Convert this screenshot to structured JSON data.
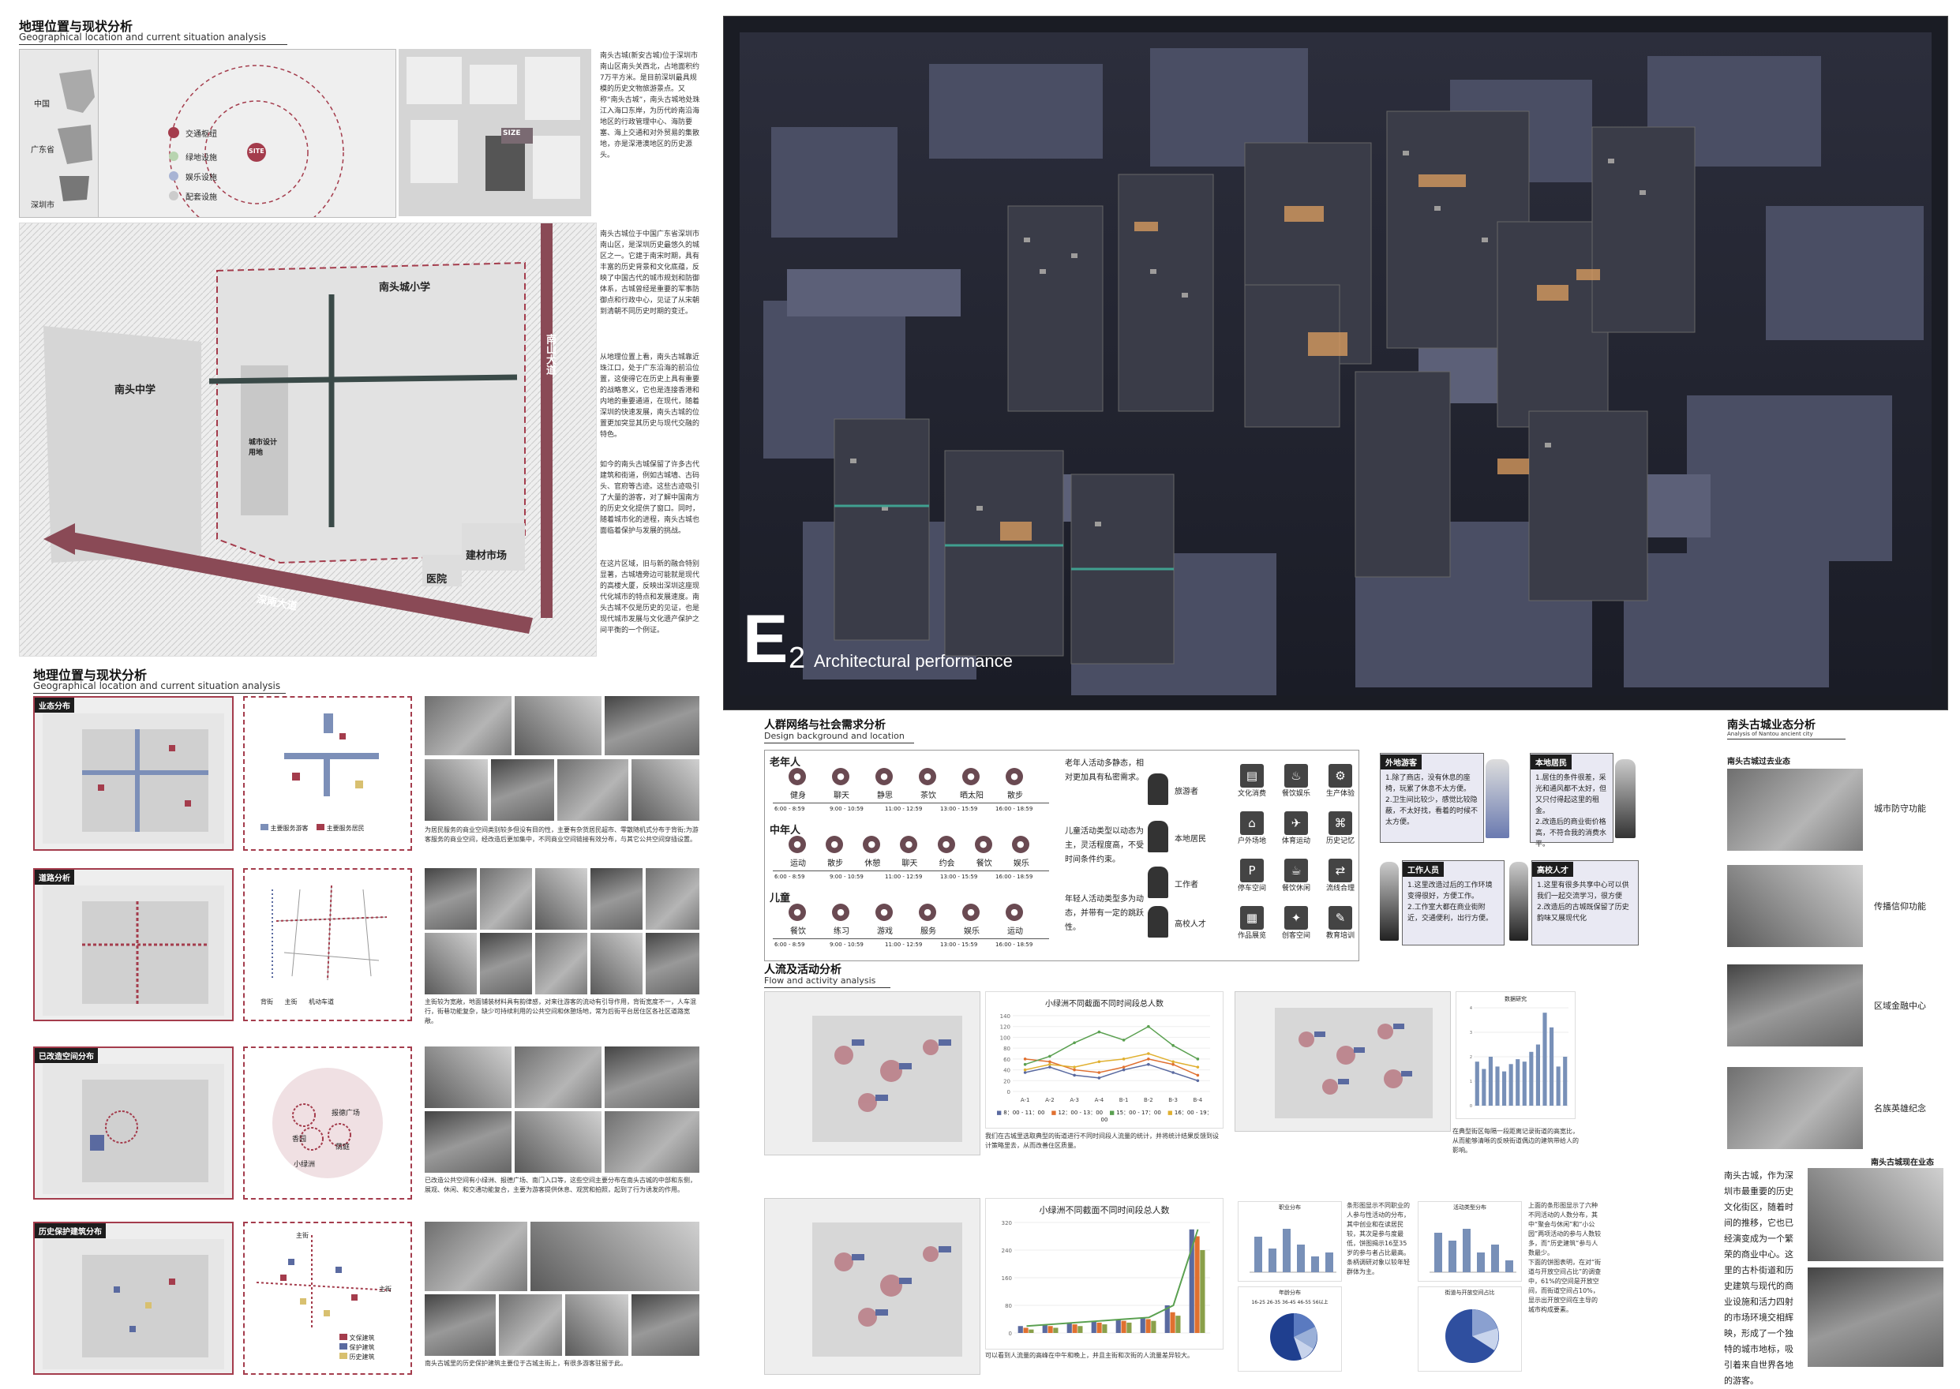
{
  "left": {
    "title_cn": "地理位置与现状分析",
    "title_en": "Geographical location and current situation analysis",
    "map_labels": {
      "china": "中国",
      "guangdong": "广东省",
      "shenzhen": "深圳市",
      "site": "SITE",
      "size": "SIZE",
      "traffic": "交通枢纽",
      "green": "绿地设施",
      "leisure": "娱乐设施",
      "support": "配套设施"
    },
    "intro_text": "南头古城(新安古城)位于深圳市南山区南头关西北，占地面积约7万平方米。是目前深圳最具规模的历史文物旅游景点。又称“南头古城”，南头古城地处珠江入海口东岸，为历代岭南沿海地区的行政管理中心、海防要塞、海上交通和对外贸易的集散地，亦是深港澳地区的历史源头。",
    "history_text": "南头古城位于中国广东省深圳市南山区，是深圳历史最悠久的城区之一。它建于南宋时期，具有丰富的历史背景和文化底蕴，反映了中国古代的城市规划和防御体系，古城曾经是重要的军事防御点和行政中心，见证了从宋朝到清朝不同历史时期的变迁。",
    "location_text": "从地理位置上看，南头古城靠近珠江口，处于广东沿海的前沿位置，这使得它在历史上具有重要的战略意义，它也是连接香港和内地的重要通道，在现代，随着深圳的快速发展，南头古城的位置更加突显其历史与现代交融的特色。",
    "preserve_text": "如今的南头古城保留了许多古代建筑和街道，例如古城墙、古码头、官府等古迹。这些古迹吸引了大量的游客，对了解中国南方的历史文化提供了窗口。同时，随着城市化的进程，南头古城也面临着保护与发展的挑战。",
    "region_text": "在这片区域，旧与新的融合特别显著，古城墙旁边可能就是现代的高楼大厦，反映出深圳这座现代化城市的特点和发展速度。南头古城不仅是历史的见证，也是现代城市发展与文化遗产保护之间平衡的一个例证。",
    "big_map_labels": {
      "school": "南头城小学",
      "middle_school": "南头中学",
      "design": "城市设计用地",
      "market": "建材市场",
      "hospital": "医院",
      "road_sn": "深南大道",
      "road_ns": "南山大道"
    }
  },
  "left2": {
    "title_cn": "地理位置与现状分析",
    "title_en": "Geographical location and current situation analysis",
    "rows": [
      {
        "label": "业态分布",
        "legend": [
          "主要服务游客",
          "主要服务居民"
        ],
        "text": "为居民服务的商业空间类别较多但没有目的性，主要有杂货居民超市、零散随机式分布于背街;为游客服务的商业空间，经改造后更加集中，不同商业空间链接有效分布，与其它公共空间穿插设置。"
      },
      {
        "label": "道路分析",
        "legend": [
          "背街",
          "主街",
          "机动车道"
        ],
        "text": "主街较为宽敞，地面铺装材料具有韵律感，对来往游客的流动有引导作用，背街宽度不一，人车混行，街巷功能复杂，缺少可持续利用的公共空间和休憩场地，常为后街平台居住区各社区道路宽敞。"
      },
      {
        "label": "已改造空间分布",
        "legend": [
          "报德广场",
          "香园",
          "小绿洲",
          "荫庭"
        ],
        "text": "已改造公共空间有小绿洲、报德广场、南门入口等，这些空间主要分布在南头古城的中部和东侧，展观、休闲、和交通功能复合，主要为游客提供休息、观赏和拍照，起到了行为诱发的作用。"
      },
      {
        "label": "历史保护建筑分布",
        "legend": [
          "文保建筑",
          "保护建筑",
          "历史建筑"
        ],
        "street_labels": [
          "主街",
          "主街"
        ],
        "text": "南头古城里的历史保护建筑主要位于古城主街上，有很多游客驻留于此。"
      }
    ]
  },
  "render": {
    "big_letter": "E",
    "number": "2",
    "caption": "Architectural performance"
  },
  "network": {
    "title_cn": "人群网络与社会需求分析",
    "title_en": "Design background and location",
    "groups": [
      {
        "name": "老年人",
        "acts": [
          "健身",
          "聊天",
          "静思",
          "茶饮",
          "晒太阳",
          "散步"
        ],
        "desc": "老年人活动多静态，相对更加具有私密需求。"
      },
      {
        "name": "中年人",
        "acts": [
          "运动",
          "散步",
          "休憩",
          "聊天",
          "约会",
          "餐饮",
          "娱乐"
        ],
        "desc": "儿童活动类型以动态为主，灵活程度高，不受时间条件约束。"
      },
      {
        "name": "儿童",
        "acts": [
          "餐饮",
          "练习",
          "游戏",
          "服务",
          "娱乐",
          "运动"
        ],
        "desc": "年轻人活动类型多为动态，并带有一定的跳跃性。"
      }
    ],
    "times": [
      "6:00 - 8:59",
      "9:00 - 10:59",
      "11:00 - 12:59",
      "13:00 - 15:59",
      "16:00 - 18:59"
    ],
    "people": [
      "旅游者",
      "本地居民",
      "工作者",
      "高校人才"
    ],
    "icons": [
      "文化消费",
      "餐饮娱乐",
      "生产体验",
      "户外场地",
      "体育运动",
      "历史记忆",
      "停车空间",
      "餐饮休闲",
      "流线合理",
      "作品展览",
      "创客空间",
      "教育培训"
    ],
    "cards": [
      {
        "h": "外地游客",
        "t": "1.除了商店，没有休息的座椅，玩累了休息不太方便。\n2.卫生间比较少，感觉比较隐蔽，不太好找，看着的时候不太方便。"
      },
      {
        "h": "本地居民",
        "t": "1.居住的条件很差，采光和通风都不太好，但又只付得起这里的租金。\n2.改造后的商业街价格高，不符合我的消费水平。"
      },
      {
        "h": "工作人员",
        "t": "1.这里改造过后的工作环境变得很好，方便工作。\n2.工作室大都在商业街附近，交通便利，出行方便。"
      },
      {
        "h": "高校人才",
        "t": "1.这里有很多共享中心可以供我们一起交流学习，很方便\n2.改造后的古城既保留了历史韵味又展现代化"
      }
    ]
  },
  "flow": {
    "title_cn": "人流及活动分析",
    "title_en": "Flow and activity analysis",
    "chart1_title": "小绿洲不同截面不同时间段总人数",
    "chart2_title": "小绿洲不同截面不同时间段总人数",
    "chart1_legend": [
      "8：00 - 11：00",
      "12：00 - 13：00",
      "15：00 - 17：00",
      "16：00 - 19：00"
    ],
    "text1": "我们在古城里选取典型的街道进行不同时间段人流量的统计，并将统计结果反馈到设计策略里去，从而改善住区质量。",
    "text2": "在典型街区每隔一段距离记录街道的高宽比，从而能够清晰的反映街道偶边的建筑带给人的影响。",
    "text3": "可以看到人流量的高峰在中午和晚上，并且主街和次街的人流量差异较大。",
    "text4": "条形图显示不同职业的人参与性活动的分布，其中创业和在读居民较，其次是参与度最低，饼图揭示16至35岁的参与者占比最高。条柄调研对象以较年轻群体为主。",
    "text5": "上面的条形图显示了六种不同活动的人数分布，其中“聚会与休闲”和“小公园”两项活动的参与人数较多，而“历史建筑”参与人数最少。\n下面的饼图表明，在对“街道与开放空间占比”的调查中，61%的空间是开放空间，而街道空间占10%，显示出开放空间在主导的城市构成要素。",
    "bar_chart_title": "数据研究",
    "small1_title": "职业分布",
    "small2_title": "活动类型分布",
    "small3_title": "年龄分布",
    "small4_title": "街道与开放空间占比",
    "pie_legend": [
      "16-25",
      "26-35",
      "36-45",
      "46-55",
      "56以上"
    ]
  },
  "chart_data": [
    {
      "type": "line",
      "title": "小绿洲不同截面不同时间段总人数",
      "categories": [
        "A-1",
        "A-2",
        "A-3",
        "A-4",
        "B-1",
        "B-2",
        "B-3",
        "B-4"
      ],
      "series": [
        {
          "name": "8：00 - 11：00",
          "values": [
            35,
            45,
            30,
            25,
            40,
            50,
            35,
            20
          ]
        },
        {
          "name": "12：00 - 13：00",
          "values": [
            60,
            55,
            40,
            35,
            45,
            60,
            50,
            30
          ]
        },
        {
          "name": "15：00 - 17：00",
          "values": [
            50,
            65,
            90,
            110,
            95,
            120,
            85,
            60
          ]
        },
        {
          "name": "16：00 - 19：00",
          "values": [
            40,
            50,
            45,
            55,
            60,
            70,
            55,
            45
          ]
        }
      ],
      "ylim": [
        0,
        140
      ]
    },
    {
      "type": "bar",
      "title": "数据研究",
      "categories": [
        "1",
        "2",
        "3",
        "4",
        "5",
        "6",
        "7",
        "8",
        "9",
        "10",
        "11",
        "12",
        "13",
        "14"
      ],
      "values": [
        1.8,
        1.5,
        2.0,
        1.6,
        1.4,
        1.7,
        1.9,
        1.8,
        2.2,
        2.5,
        3.8,
        3.2,
        1.6,
        2.0
      ],
      "ylim": [
        0,
        4
      ]
    },
    {
      "type": "bar",
      "title": "小绿洲不同截面不同时间段总人数",
      "categories": [
        "1",
        "2",
        "3",
        "4",
        "5",
        "6",
        "7",
        "8"
      ],
      "series": [
        {
          "name": "a",
          "values": [
            20,
            25,
            30,
            35,
            40,
            45,
            80,
            300
          ]
        },
        {
          "name": "b",
          "values": [
            15,
            20,
            25,
            30,
            35,
            40,
            60,
            280
          ]
        },
        {
          "name": "c",
          "values": [
            10,
            15,
            20,
            25,
            30,
            35,
            50,
            240
          ]
        }
      ],
      "ylim": [
        0,
        320
      ]
    }
  ]
}
